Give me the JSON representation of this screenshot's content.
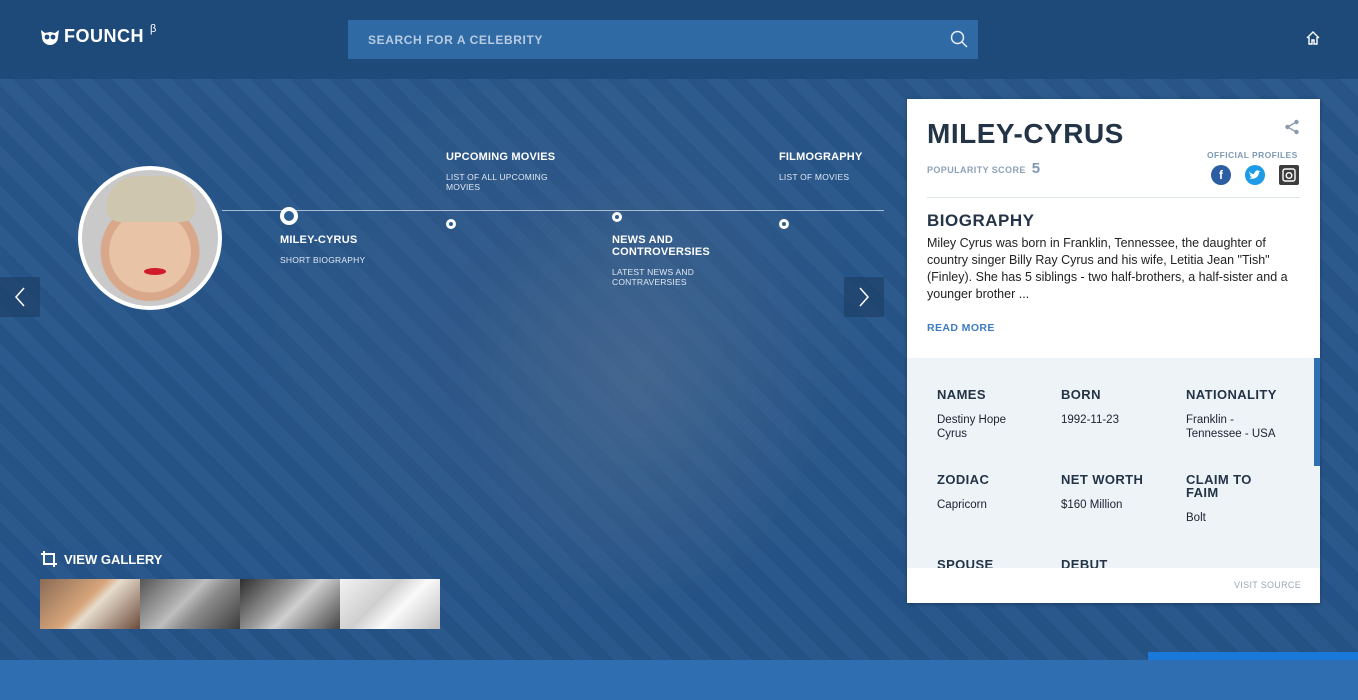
{
  "header": {
    "logo_text": "FOUNCH",
    "logo_badge": "β",
    "search_placeholder": "SEARCH FOR A CELEBRITY"
  },
  "timeline": {
    "items": [
      {
        "title": "MILEY-CYRUS",
        "subtitle": "SHORT BIOGRAPHY"
      },
      {
        "title": "UPCOMING MOVIES",
        "subtitle": "LIST OF ALL UPCOMING MOVIES"
      },
      {
        "title": "NEWS AND CONTROVERSIES",
        "subtitle": "LATEST NEWS AND CONTRAVERSIES"
      },
      {
        "title": "FILMOGRAPHY",
        "subtitle": "LIST OF MOVIES"
      }
    ]
  },
  "gallery": {
    "label": "VIEW GALLERY"
  },
  "card": {
    "name": "MILEY-CYRUS",
    "popularity_label": "POPULARITY SCORE",
    "popularity_value": "5",
    "official_profiles_label": "OFFICIAL PROFILES",
    "bio_title": "BIOGRAPHY",
    "bio_text": "Miley Cyrus was born in Franklin, Tennessee, the daughter of country singer Billy Ray Cyrus and his wife, Letitia Jean \"Tish\" (Finley). She has 5 siblings - two half-brothers, a half-sister and a younger brother ...",
    "read_more": "READ MORE",
    "facts": [
      {
        "key": "NAMES",
        "value": "Destiny Hope Cyrus"
      },
      {
        "key": "BORN",
        "value": "1992-11-23"
      },
      {
        "key": "NATIONALITY",
        "value": "Franklin - Tennessee - USA"
      },
      {
        "key": "ZODIAC",
        "value": "Capricorn"
      },
      {
        "key": "NET WORTH",
        "value": "$160 Million"
      },
      {
        "key": "CLAIM TO FAIM",
        "value": "Bolt"
      },
      {
        "key": "SPOUSE",
        "value": ""
      },
      {
        "key": "DEBUT",
        "value": ""
      }
    ],
    "visit_source": "VISIT SOURCE"
  },
  "colors": {
    "header_bg": "#1e4a7a",
    "search_bg": "#2f6aa5",
    "accent_blue": "#3c7bc0",
    "card_heading": "#233447"
  }
}
